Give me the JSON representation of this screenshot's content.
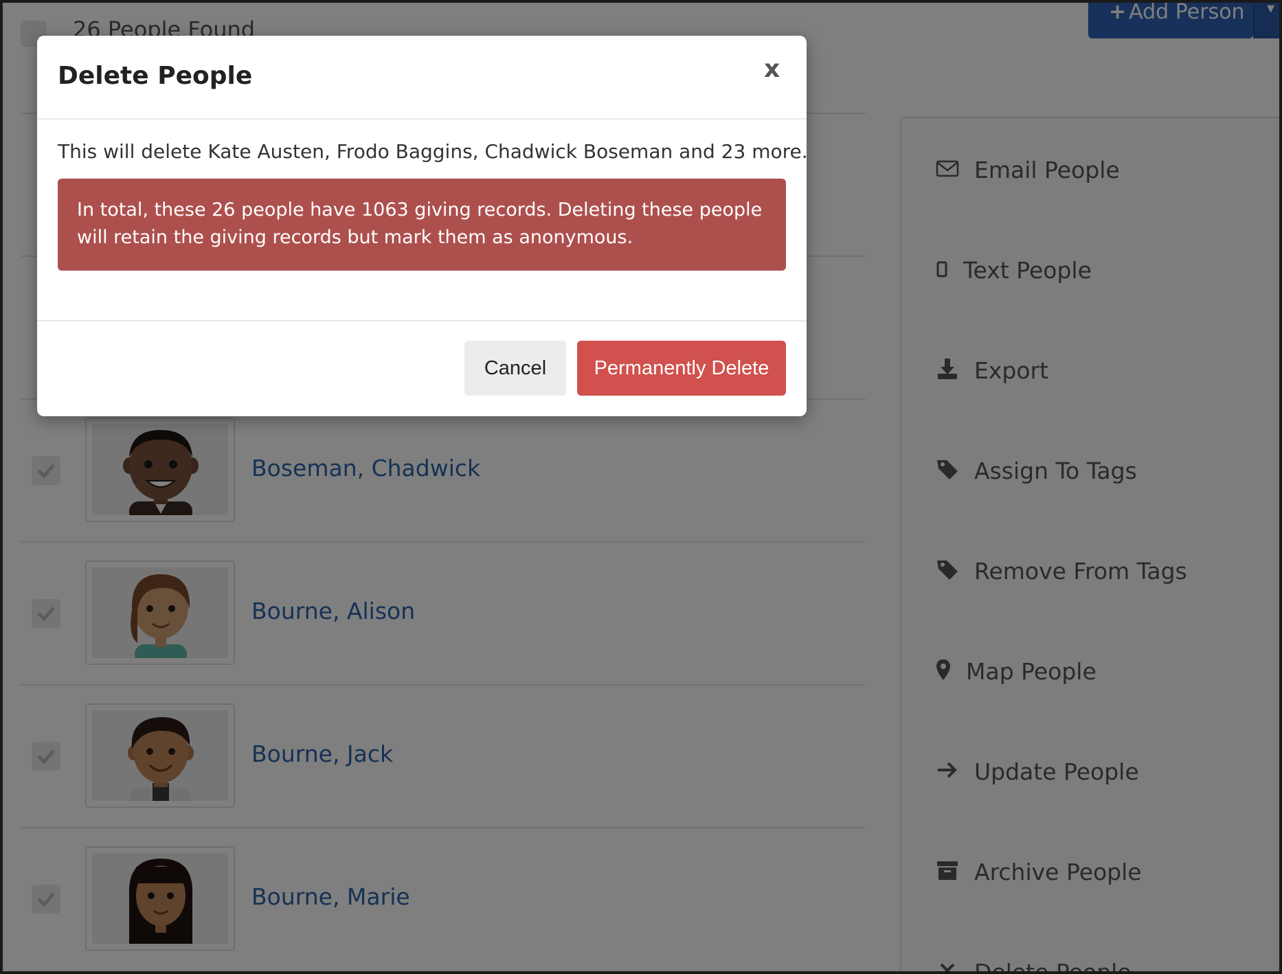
{
  "list_header": {
    "count_text": "26 People Found",
    "add_person_label": "Add Person"
  },
  "people": [
    {
      "name": "Boseman, Chadwick"
    },
    {
      "name": "Bourne, Alison"
    },
    {
      "name": "Bourne, Jack"
    },
    {
      "name": "Bourne, Marie"
    }
  ],
  "actions": [
    {
      "label": "Email People",
      "icon": "envelope-icon"
    },
    {
      "label": "Text People",
      "icon": "mobile-phone-icon"
    },
    {
      "label": "Export",
      "icon": "download-icon"
    },
    {
      "label": "Assign To Tags",
      "icon": "tag-icon"
    },
    {
      "label": "Remove From Tags",
      "icon": "tag-icon"
    },
    {
      "label": "Map People",
      "icon": "map-marker-icon"
    },
    {
      "label": "Update People",
      "icon": "arrow-right-icon"
    },
    {
      "label": "Archive People",
      "icon": "archive-box-icon"
    },
    {
      "label": "Delete People",
      "icon": "x-icon"
    }
  ],
  "modal": {
    "title": "Delete People",
    "close_label": "x",
    "message": "This will delete Kate Austen, Frodo Baggins, Chadwick Boseman and 23 more.",
    "alert_line1": "In total, these 26 people have 1063 giving records. Deleting these people",
    "alert_line2": "will retain the giving records but mark them as anonymous.",
    "cancel_label": "Cancel",
    "confirm_label": "Permanently Delete"
  },
  "colors": {
    "primary": "#2f63b5",
    "link": "#2a64a8",
    "danger_button": "#d0514d",
    "danger_alert": "#ad504d"
  }
}
